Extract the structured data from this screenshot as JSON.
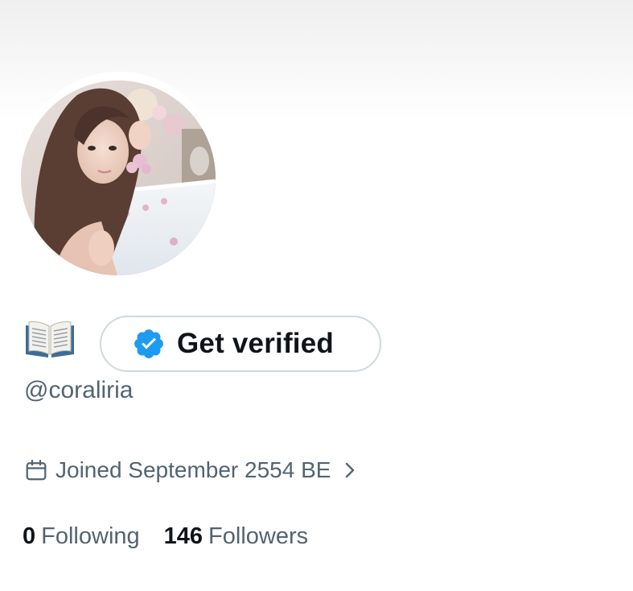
{
  "profile": {
    "display_name_icon": "open-book-emoji",
    "verify_button_label": "Get verified",
    "verify_icon": "verified-badge-icon",
    "handle": "@coraliria",
    "joined_text": "Joined September 2554 BE",
    "joined_icon": "calendar-icon",
    "following_count": "0",
    "following_label": "Following",
    "followers_count": "146",
    "followers_label": "Followers"
  },
  "colors": {
    "text_primary": "#0f1419",
    "text_secondary": "#536471",
    "verified_blue": "#1d9bf0",
    "button_border": "#cfd9de"
  }
}
